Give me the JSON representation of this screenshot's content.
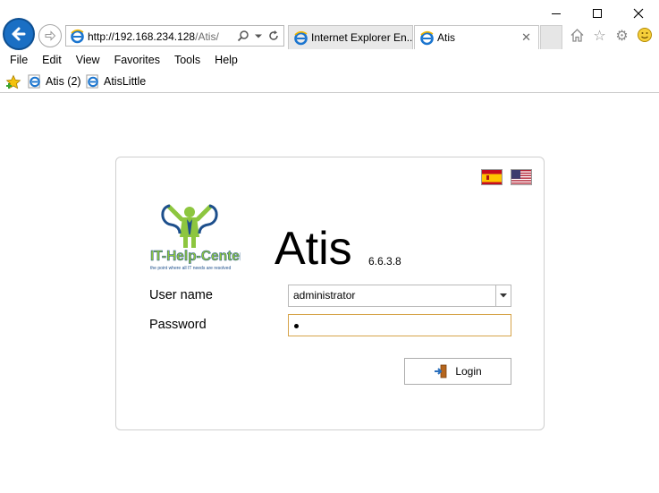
{
  "browser": {
    "address_host": "http://192.168.234.128",
    "address_path": "/Atis/",
    "tabs": [
      {
        "label": "Internet Explorer En..."
      },
      {
        "label": "Atis"
      }
    ],
    "menu": [
      "File",
      "Edit",
      "View",
      "Favorites",
      "Tools",
      "Help"
    ],
    "favorites": [
      {
        "label": "Atis (2)"
      },
      {
        "label": "AtisLittle"
      }
    ]
  },
  "login": {
    "logo_text": "IT-Help-Center",
    "logo_tagline": "the point where all IT needs are resolved",
    "app_name": "Atis",
    "version": "6.6.3.8",
    "username_label": "User name",
    "username_value": "administrator",
    "password_label": "Password",
    "login_button": "Login",
    "languages": [
      "es",
      "en"
    ]
  },
  "colors": {
    "ie_blue": "#1a6fc4",
    "logo_green": "#8dc63f",
    "logo_blue": "#1d4f8c",
    "password_focus_border": "#d6a44a"
  }
}
